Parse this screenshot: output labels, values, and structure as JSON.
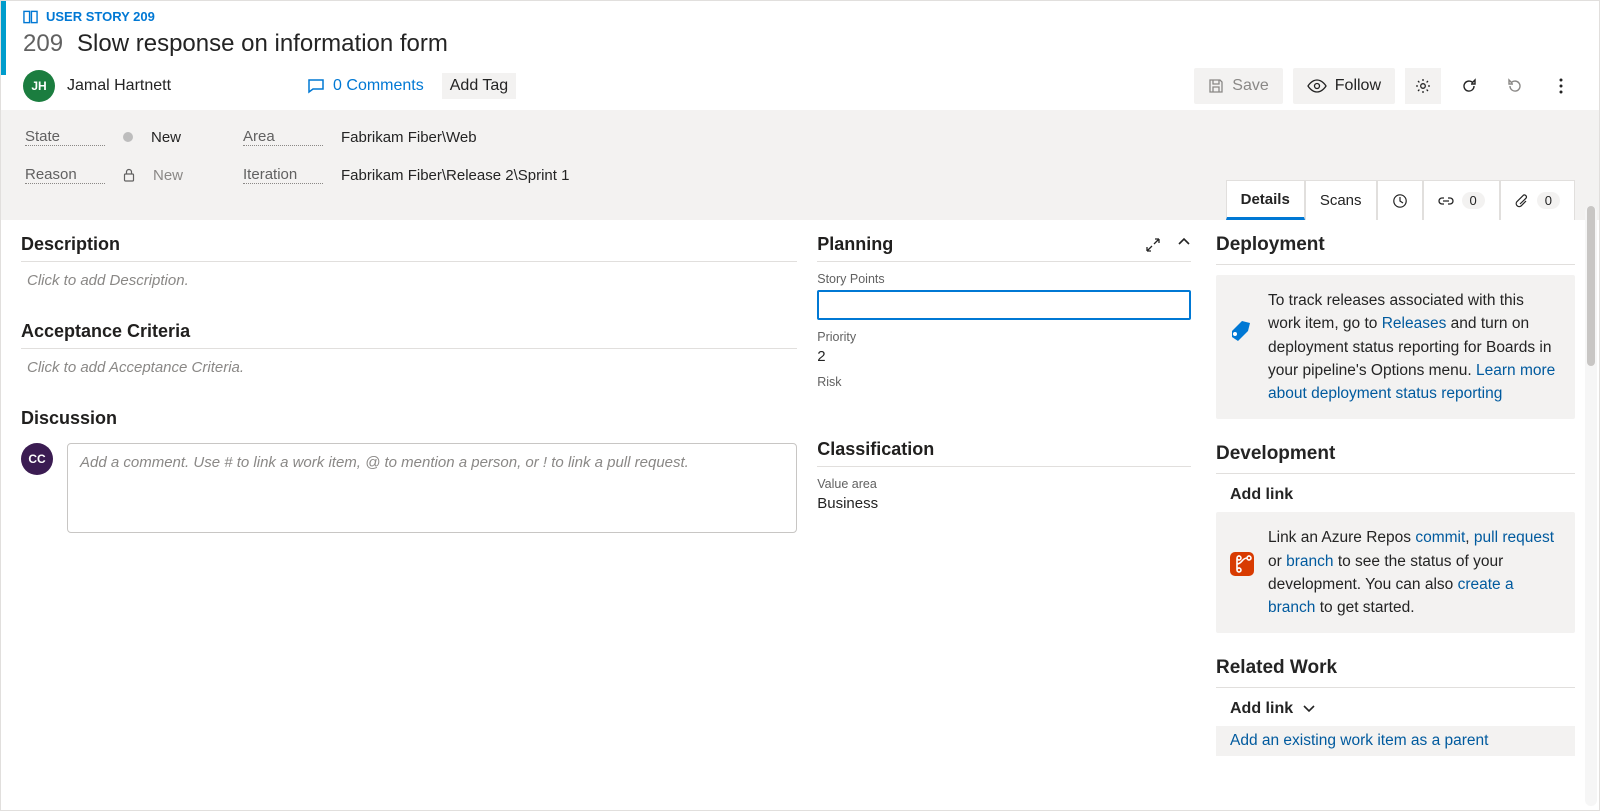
{
  "crumb": {
    "type_label": "USER STORY 209"
  },
  "item": {
    "id": "209",
    "title": "Slow response on information form"
  },
  "assignee": {
    "initials": "JH",
    "name": "Jamal Hartnett"
  },
  "comments": {
    "label": "0 Comments"
  },
  "add_tag_label": "Add Tag",
  "toolbar": {
    "save": "Save",
    "follow": "Follow"
  },
  "fields": {
    "state_label": "State",
    "state_value": "New",
    "reason_label": "Reason",
    "reason_value": "New",
    "area_label": "Area",
    "area_value": "Fabrikam Fiber\\Web",
    "iteration_label": "Iteration",
    "iteration_value": "Fabrikam Fiber\\Release 2\\Sprint 1"
  },
  "tabs": {
    "details": "Details",
    "scans": "Scans",
    "links_count": "0",
    "attach_count": "0"
  },
  "sections": {
    "description": "Description",
    "description_ph": "Click to add Description.",
    "accept": "Acceptance Criteria",
    "accept_ph": "Click to add Acceptance Criteria.",
    "discussion": "Discussion",
    "discussion_ph": "Add a comment. Use # to link a work item, @ to mention a person, or ! to link a pull request.",
    "discussion_avatar": "CC",
    "planning": "Planning",
    "story_points": "Story Points",
    "story_points_val": "",
    "priority": "Priority",
    "priority_val": "2",
    "risk": "Risk",
    "risk_val": "",
    "classification": "Classification",
    "value_area": "Value area",
    "value_area_val": "Business"
  },
  "right": {
    "deployment": "Deployment",
    "deploy_text_pre": "To track releases associated with this work item, go to ",
    "deploy_link1": "Releases",
    "deploy_text_mid": " and turn on deployment status reporting for Boards in your pipeline's Options menu. ",
    "deploy_link2": "Learn more about deployment status reporting",
    "development": "Development",
    "dev_addlink": "Add link",
    "dev_pre": "Link an Azure Repos ",
    "dev_commit": "commit",
    "dev_pull": "pull request",
    "dev_branch": "branch",
    "dev_mid": " to see the status of your development. You can also ",
    "dev_create": "create a branch",
    "dev_post": " to get started.",
    "related": "Related Work",
    "rel_addlink": "Add link",
    "rel_parent": "Add an existing work item as a parent"
  }
}
